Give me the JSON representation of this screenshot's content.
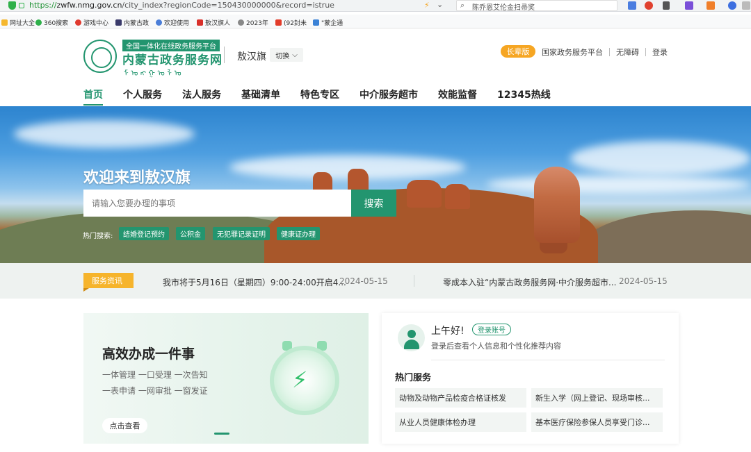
{
  "browser": {
    "url_scheme": "https://",
    "url_host": "zwfw.nmg.gov.cn",
    "url_path": "/city_index?regionCode=150430000000&record=istrue",
    "search_text": "陈乔恩艾伦金扫帚奖",
    "bookmarks": [
      "网址大全",
      "360搜索",
      "游戏中心",
      "内蒙古政",
      "欢迎使用",
      "敖汉旗人",
      "2023年",
      "(92封未",
      "\"蒙企通"
    ]
  },
  "header": {
    "logo_tag": "全国一体化在线政务服务平台",
    "logo_title": "内蒙古政务服务网",
    "logo_mongolian": "ᠮᠣᠩᠭᠣᠯ",
    "region": "敖汉旗",
    "switch_label": "切换",
    "elder_label": "长辈版",
    "links": [
      "国家政务服务平台",
      "无障碍",
      "登录"
    ]
  },
  "nav": [
    "首页",
    "个人服务",
    "法人服务",
    "基础清单",
    "特色专区",
    "中介服务超市",
    "效能监督",
    "12345热线"
  ],
  "hero": {
    "title": "欢迎来到敖汉旗",
    "search_placeholder": "请输入您要办理的事项",
    "search_button": "搜索",
    "hot_label": "热门搜索:",
    "hot_tags": [
      "结婚登记预约",
      "公积金",
      "无犯罪记录证明",
      "健康证办理"
    ]
  },
  "news": {
    "badge": "服务资讯",
    "items": [
      {
        "text": "我市将于5月16日（星期四）9:00-24:00开启4...",
        "date": "2024-05-15"
      },
      {
        "text": "零成本入驻“内蒙古政务服务网·中介服务超市...",
        "date": "2024-05-15"
      }
    ]
  },
  "promo": {
    "title": "高效办成一件事",
    "line1": "一体管理 一口受理 一次告知",
    "line2": "一表申请 一网审批 一窗发证",
    "button": "点击查看"
  },
  "user": {
    "greeting": "上午好!",
    "login_pill": "登录账号",
    "subtitle": "登录后查看个人信息和个性化推荐内容",
    "hot_title": "热门服务",
    "services": [
      "动物及动物产品检疫合格证核发",
      "新生入学（网上登记、现场审核...",
      "从业人员健康体检办理",
      "基本医疗保险参保人员享受门诊..."
    ]
  },
  "colors": {
    "brand_green": "#23956f",
    "accent_orange": "#f6a623",
    "news_badge": "#f6b42c"
  }
}
